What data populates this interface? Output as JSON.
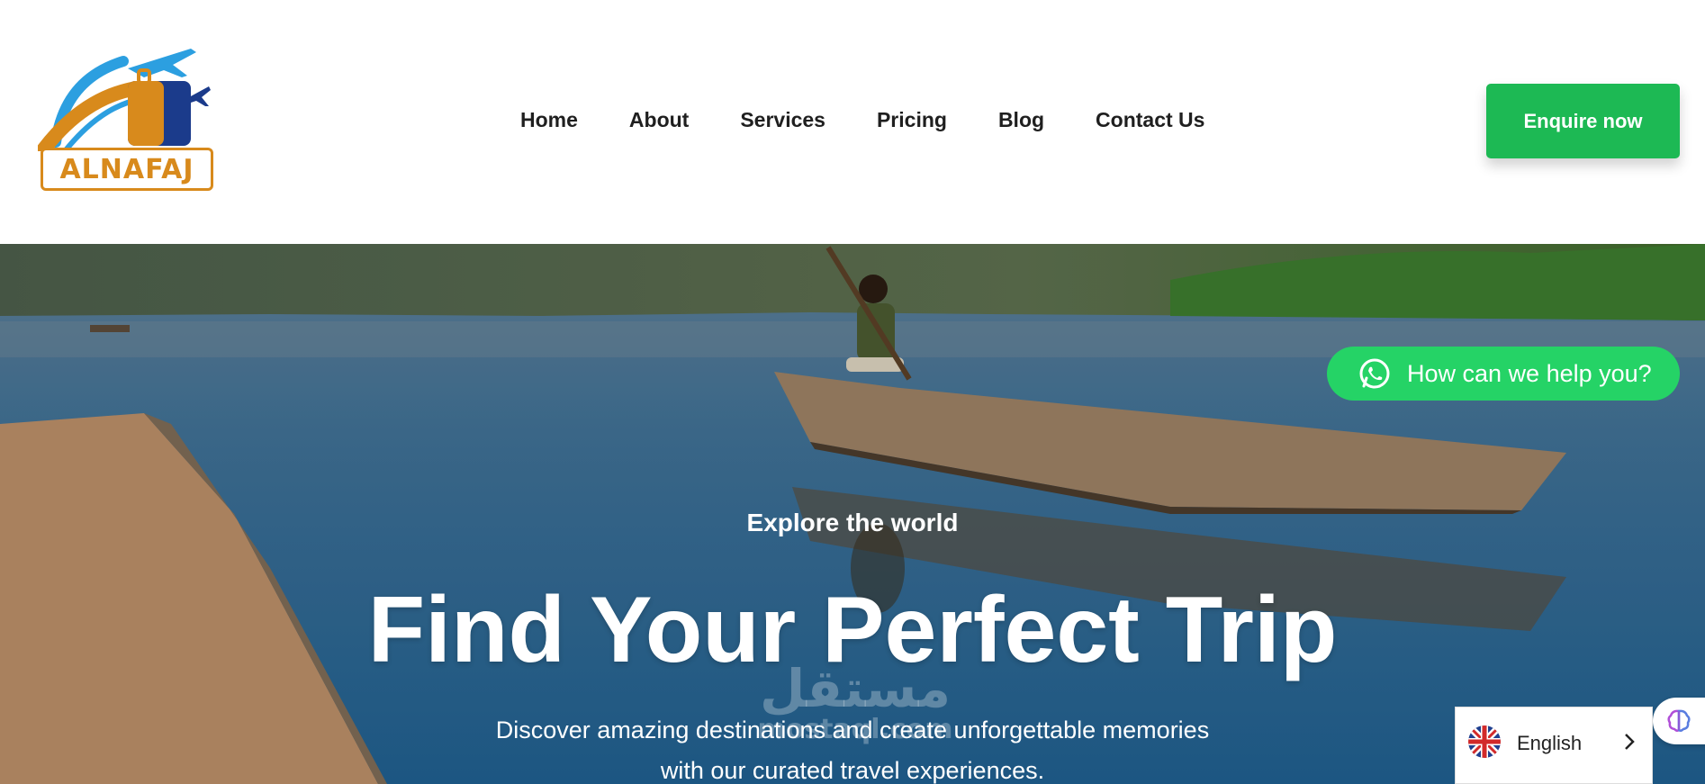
{
  "brand": {
    "name": "ALNAFAJ",
    "colors": {
      "orange": "#d88a1c",
      "blue": "#2c9fe0",
      "navy": "#1b3b8b"
    }
  },
  "nav": {
    "items": [
      "Home",
      "About",
      "Services",
      "Pricing",
      "Blog",
      "Contact Us"
    ]
  },
  "header": {
    "cta_label": "Enquire now",
    "cta_color": "#1db954"
  },
  "hero": {
    "kicker": "Explore the world",
    "title": "Find Your Perfect Trip",
    "description_line1": "Discover amazing destinations and create unforgettable memories",
    "description_line2": "with our curated travel experiences."
  },
  "watermark": {
    "arabic": "مستقل",
    "latin": "mostaql.com"
  },
  "whatsapp": {
    "label": "How can we help you?",
    "icon": "whatsapp-icon",
    "color": "#25d366"
  },
  "side_widget": {
    "icon": "brain-icon"
  },
  "language": {
    "label": "English",
    "flag": "uk-flag-icon"
  }
}
